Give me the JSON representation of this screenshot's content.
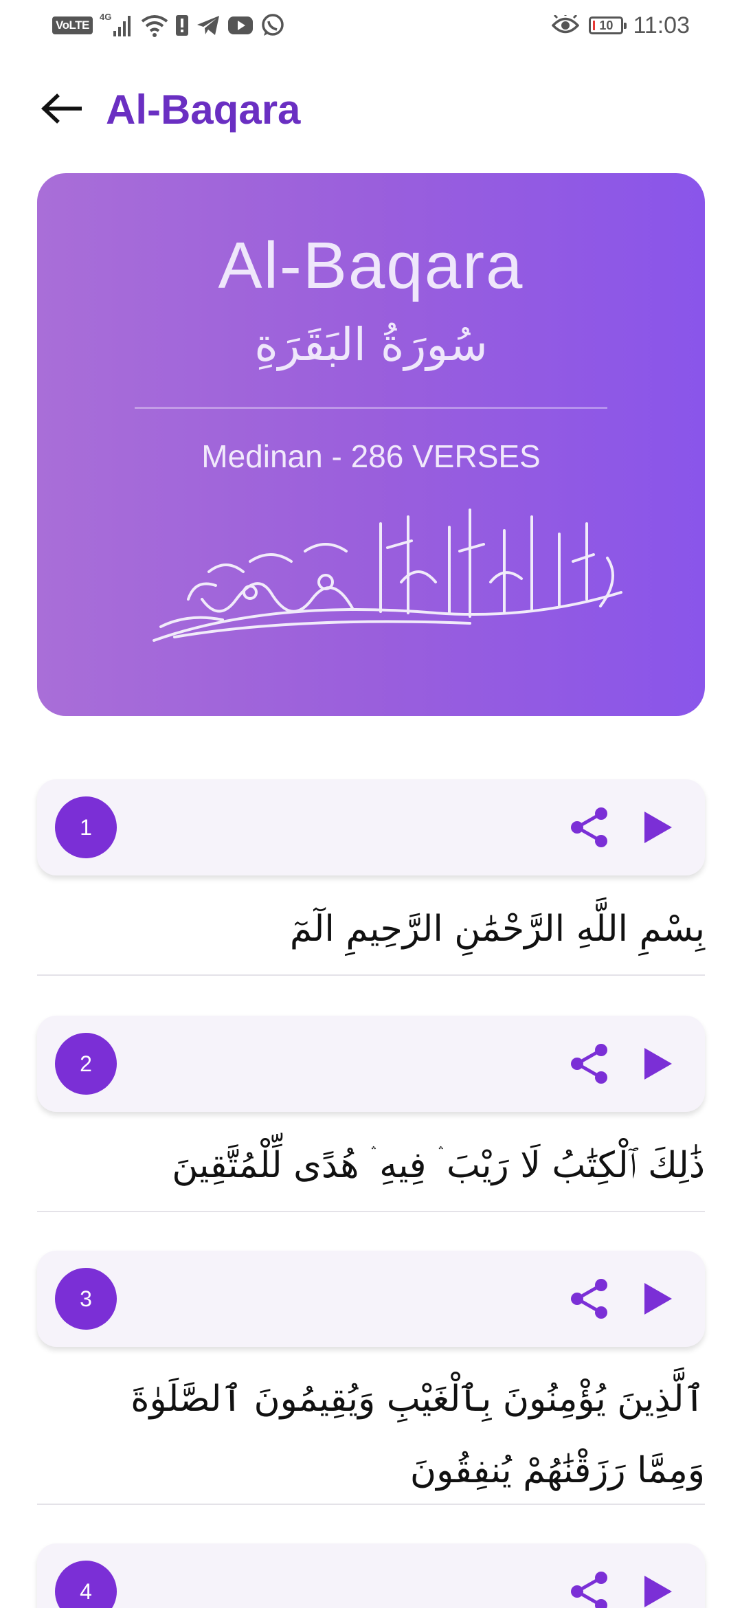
{
  "status_bar": {
    "volte": "VoLTE",
    "network": "4G",
    "time": "11:03",
    "battery": "10",
    "icons": [
      "signal-icon",
      "wifi-icon",
      "alert-icon",
      "telegram-icon",
      "youtube-icon",
      "whatsapp-icon",
      "eye-icon",
      "battery-icon"
    ]
  },
  "app_bar": {
    "title": "Al-Baqara",
    "back_icon": "arrow-left-icon"
  },
  "header": {
    "surah_name": "Al-Baqara",
    "surah_arabic": "سُورَةُ البَقَرَةِ",
    "meta": "Medinan - 286 VERSES",
    "calligraphy_icon": "bismillah-calligraphy"
  },
  "verses": [
    {
      "number": "1",
      "text": "بِسْمِ اللَّهِ الرَّحْمَٰنِ الرَّحِيمِ الٓمٓ"
    },
    {
      "number": "2",
      "text": "ذَٰلِكَ ٱلْكِتَٰبُ لَا رَيْبَ ۛ فِيهِ ۛ هُدًى لِّلْمُتَّقِينَ"
    },
    {
      "number": "3",
      "text": "ٱلَّذِينَ يُؤْمِنُونَ بِٱلْغَيْبِ وَيُقِيمُونَ ٱلصَّلَوٰةَ وَمِمَّا رَزَقْنَٰهُمْ يُنفِقُونَ"
    },
    {
      "number": "4",
      "text": ""
    }
  ],
  "colors": {
    "accent": "#7b2fd6",
    "title": "#6a2fc2",
    "card_gradient_start": "#a96ed8",
    "card_gradient_end": "#8a55ea"
  }
}
